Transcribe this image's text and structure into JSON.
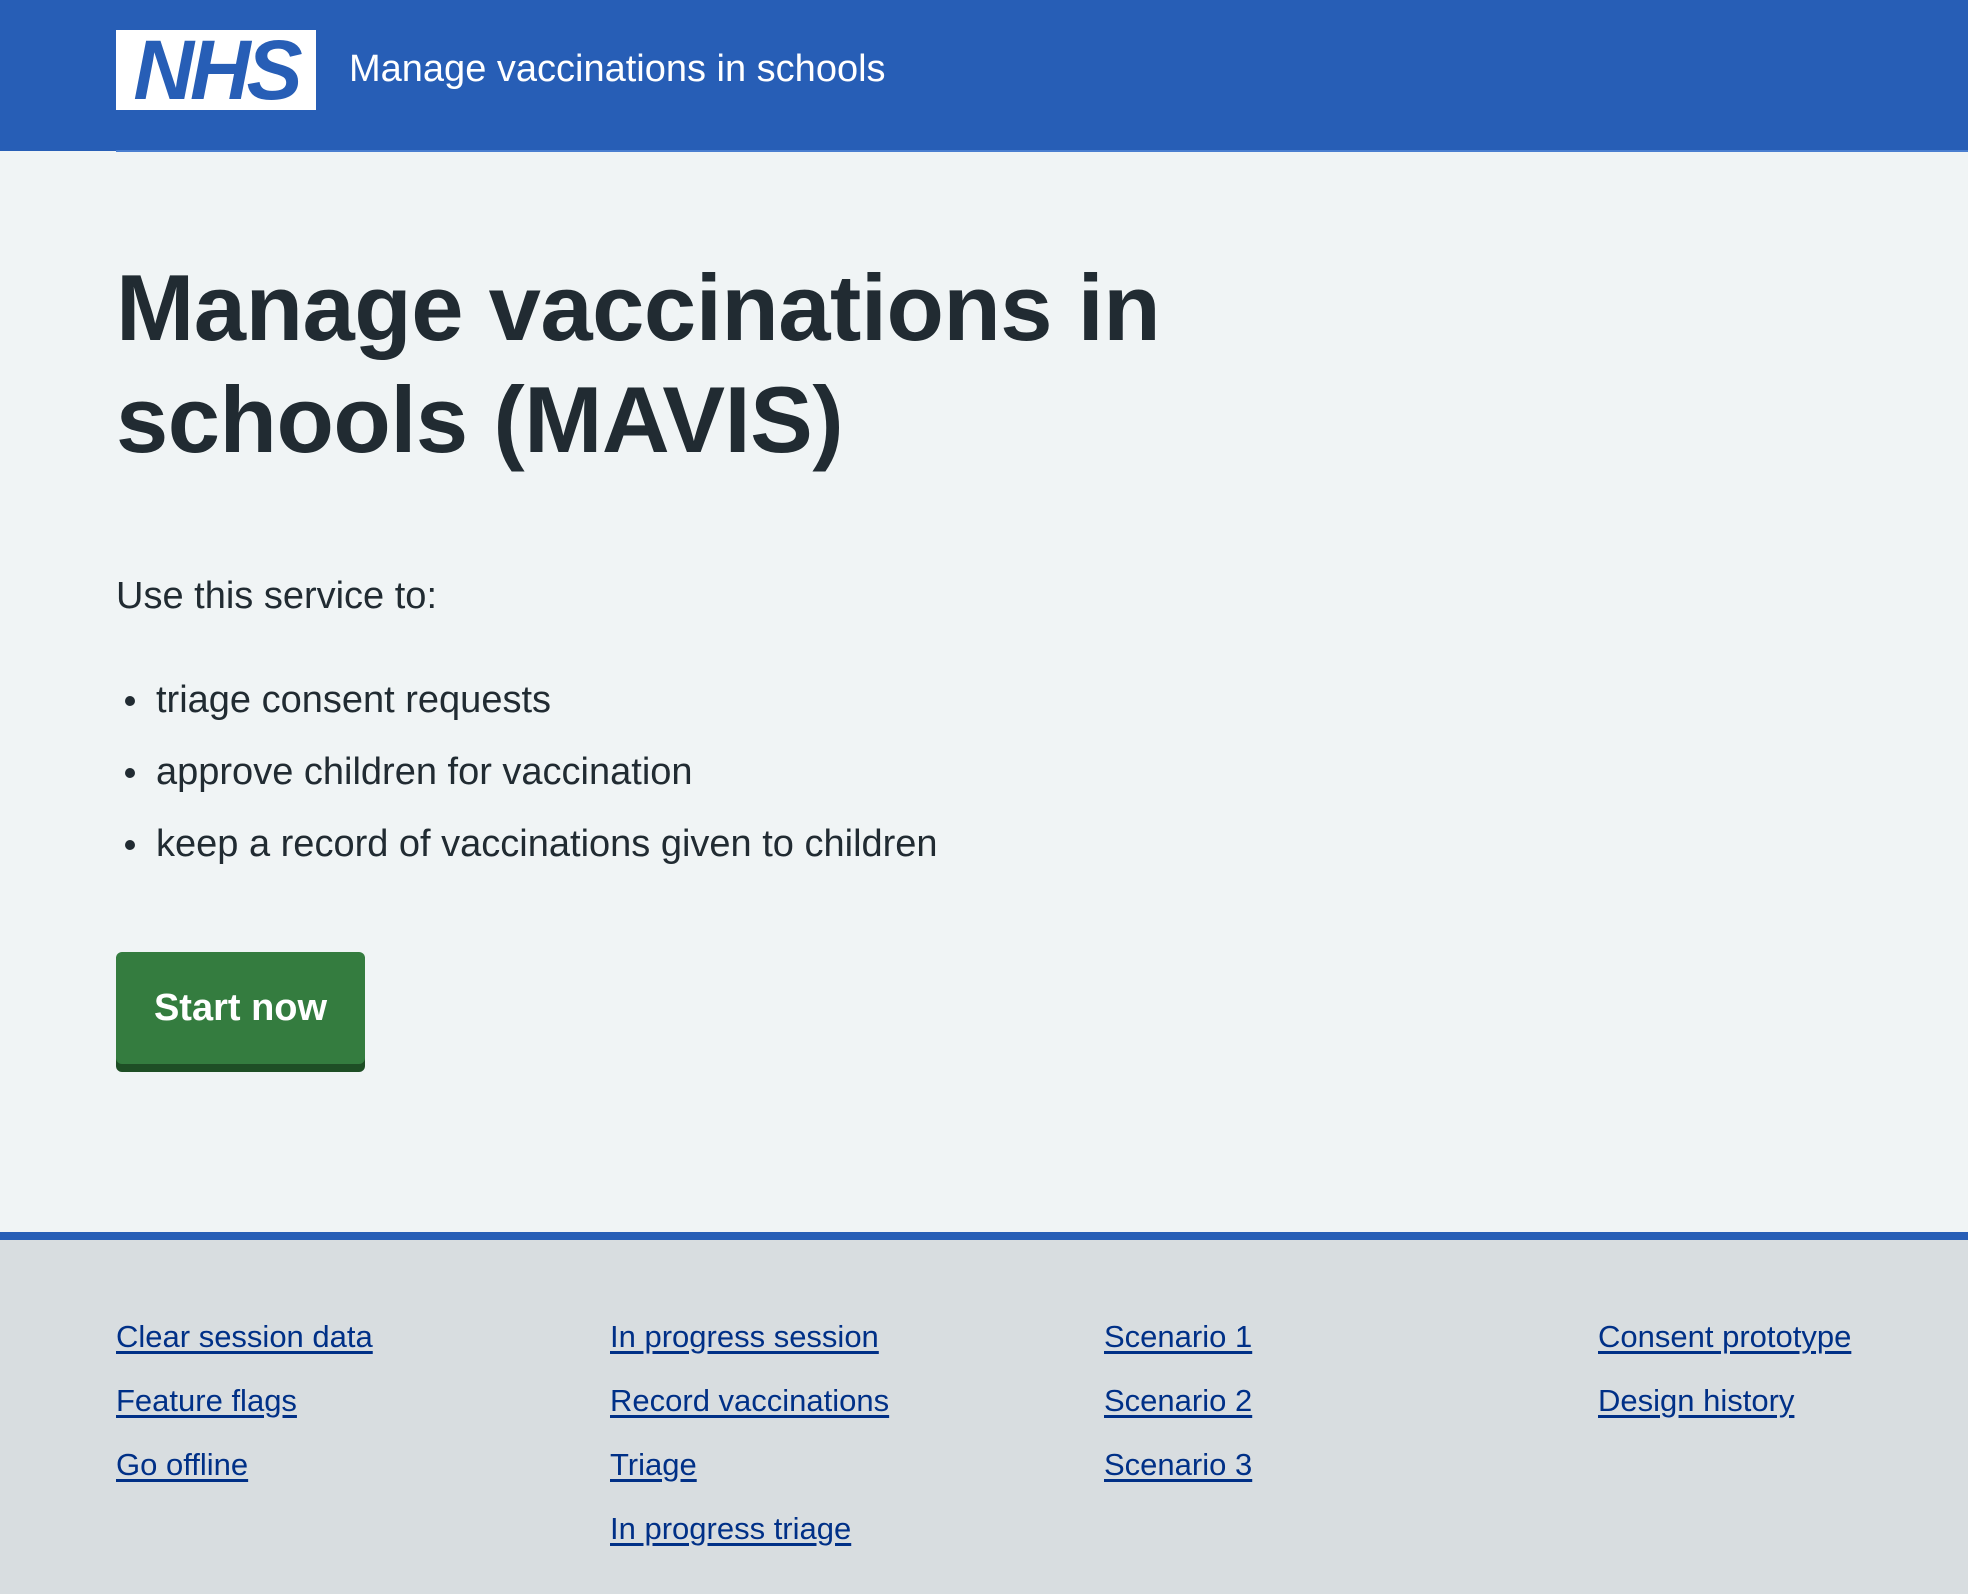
{
  "header": {
    "logo_text": "NHS",
    "service_name": "Manage vaccinations in schools",
    "background_color": "#275eb6"
  },
  "main": {
    "title": "Manage vaccinations in schools (MAVIS)",
    "intro": "Use this service to:",
    "bullets": [
      "triage consent requests",
      "approve children for vaccination",
      "keep a record of vaccinations given to children"
    ],
    "start_button_label": "Start now",
    "start_button_color": "#347c3f"
  },
  "footer": {
    "columns": [
      [
        "Clear session data",
        "Feature flags",
        "Go offline"
      ],
      [
        "In progress session",
        "Record vaccinations",
        "Triage",
        "In progress triage"
      ],
      [
        "Scenario 1",
        "Scenario 2",
        "Scenario 3"
      ],
      [
        "Consent prototype",
        "Design history"
      ]
    ],
    "link_color": "#003087"
  }
}
